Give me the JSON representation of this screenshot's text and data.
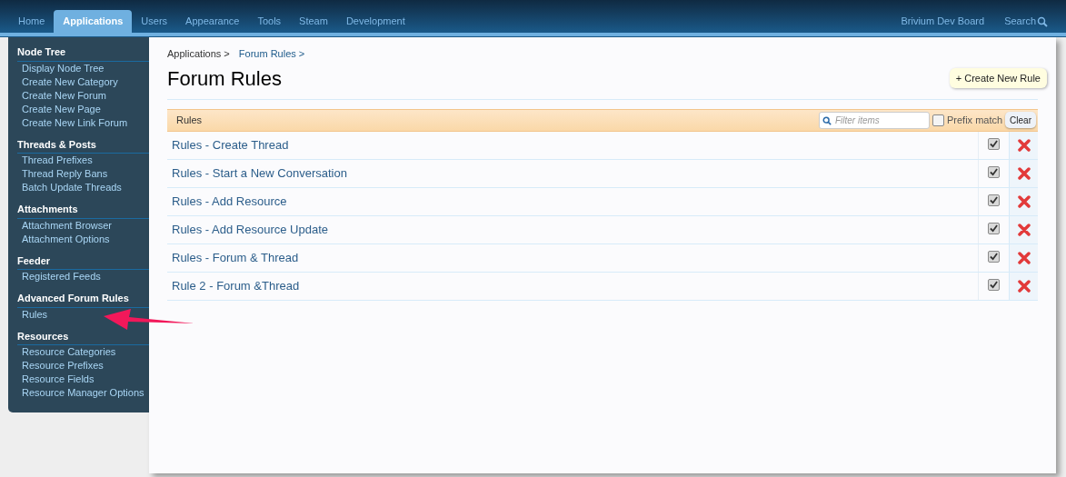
{
  "nav": {
    "tabs": [
      {
        "label": "Home",
        "selected": false
      },
      {
        "label": "Applications",
        "selected": true
      },
      {
        "label": "Users",
        "selected": false
      },
      {
        "label": "Appearance",
        "selected": false
      },
      {
        "label": "Tools",
        "selected": false
      },
      {
        "label": "Steam",
        "selected": false
      },
      {
        "label": "Development",
        "selected": false
      }
    ],
    "board": "Brivium Dev Board",
    "search": "Search"
  },
  "sidebar": {
    "sections": [
      {
        "heading": "Node Tree",
        "items": [
          "Display Node Tree",
          "Create New Category",
          "Create New Forum",
          "Create New Page",
          "Create New Link Forum"
        ]
      },
      {
        "heading": "Threads & Posts",
        "items": [
          "Thread Prefixes",
          "Thread Reply Bans",
          "Batch Update Threads"
        ]
      },
      {
        "heading": "Attachments",
        "items": [
          "Attachment Browser",
          "Attachment Options"
        ]
      },
      {
        "heading": "Feeder",
        "items": [
          "Registered Feeds"
        ]
      },
      {
        "heading": "Advanced Forum Rules",
        "items": [
          "Rules"
        ]
      },
      {
        "heading": "Resources",
        "items": [
          "Resource Categories",
          "Resource Prefixes",
          "Resource Fields",
          "Resource Manager Options"
        ]
      }
    ]
  },
  "breadcrumb": [
    "Applications >",
    "Forum Rules >"
  ],
  "title": "Forum Rules",
  "create_button": "+ Create New Rule",
  "list": {
    "heading": "Rules",
    "filter_placeholder": "Filter items",
    "prefix_match": {
      "label": "Prefix match",
      "checked": false
    },
    "clear": "Clear",
    "rows": [
      {
        "name": "Rules - Create Thread",
        "enabled": true
      },
      {
        "name": "Rules - Start a New Conversation",
        "enabled": true
      },
      {
        "name": "Rules - Add Resource",
        "enabled": true
      },
      {
        "name": "Rules - Add Resource Update",
        "enabled": true
      },
      {
        "name": "Rules - Forum & Thread",
        "enabled": true
      },
      {
        "name": "Rule 2 - Forum &Thread",
        "enabled": true
      }
    ]
  }
}
